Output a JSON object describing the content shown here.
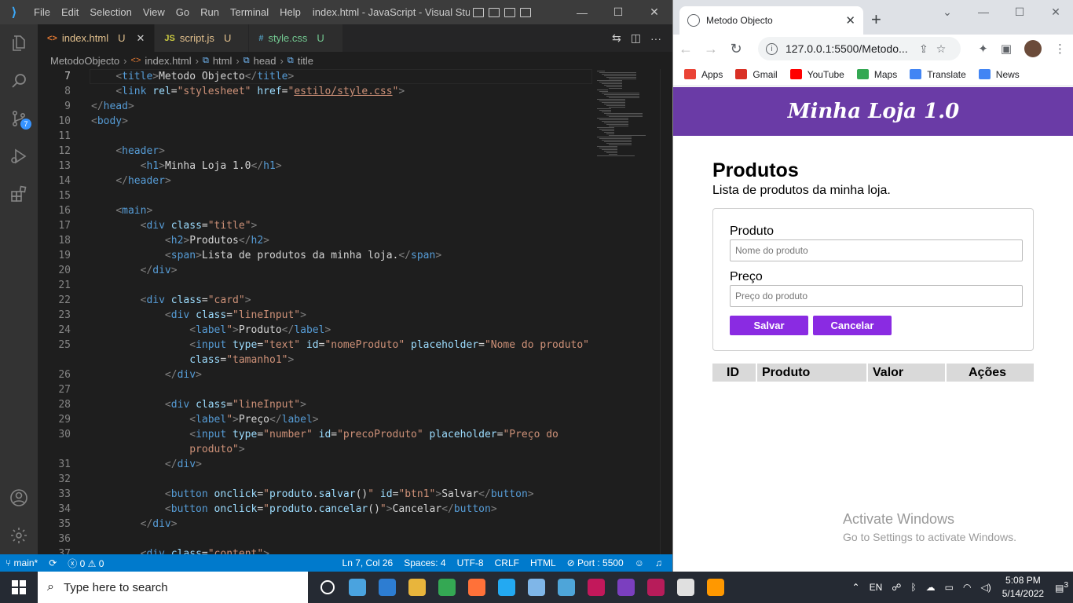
{
  "vscode": {
    "menu": [
      "File",
      "Edit",
      "Selection",
      "View",
      "Go",
      "Run",
      "Terminal",
      "Help"
    ],
    "window_title": "index.html - JavaScript - Visual Studio ...",
    "tabs": [
      {
        "icon": "<>",
        "label": "index.html",
        "status": "U",
        "active": true
      },
      {
        "icon": "JS",
        "label": "script.js",
        "status": "U",
        "active": false
      },
      {
        "icon": "#",
        "label": "style.css",
        "status": "U",
        "active": false
      }
    ],
    "breadcrumb": [
      "MetodoObjecto",
      "index.html",
      "html",
      "head",
      "title"
    ],
    "activity_badge": "7",
    "lines": [
      {
        "n": "7",
        "html": "    <span class='t'>&lt;</span><span class='tg'>title</span><span class='t'>&gt;</span><span class='tx'>Metodo Objecto</span><span class='t'>&lt;/</span><span class='tg'>title</span><span class='t'>&gt;</span>"
      },
      {
        "n": "8",
        "html": "    <span class='t'>&lt;</span><span class='tg'>link</span> <span class='at'>rel</span><span class='tx'>=</span><span class='st'>\"stylesheet\"</span> <span class='at'>href</span><span class='tx'>=</span><span class='st'>\"<span class='ul'>estilo/style.css</span>\"</span><span class='t'>&gt;</span>"
      },
      {
        "n": "9",
        "html": "<span class='t'>&lt;/</span><span class='tg'>head</span><span class='t'>&gt;</span>"
      },
      {
        "n": "10",
        "html": "<span class='t'>&lt;</span><span class='tg'>body</span><span class='t'>&gt;</span>"
      },
      {
        "n": "11",
        "html": ""
      },
      {
        "n": "12",
        "html": "    <span class='t'>&lt;</span><span class='tg'>header</span><span class='t'>&gt;</span>"
      },
      {
        "n": "13",
        "html": "        <span class='t'>&lt;</span><span class='tg'>h1</span><span class='t'>&gt;</span><span class='tx'>Minha Loja 1.0</span><span class='t'>&lt;/</span><span class='tg'>h1</span><span class='t'>&gt;</span>"
      },
      {
        "n": "14",
        "html": "    <span class='t'>&lt;/</span><span class='tg'>header</span><span class='t'>&gt;</span>"
      },
      {
        "n": "15",
        "html": ""
      },
      {
        "n": "16",
        "html": "    <span class='t'>&lt;</span><span class='tg'>main</span><span class='t'>&gt;</span>"
      },
      {
        "n": "17",
        "html": "        <span class='t'>&lt;</span><span class='tg'>div</span> <span class='at'>class</span><span class='tx'>=</span><span class='st'>\"title\"</span><span class='t'>&gt;</span>"
      },
      {
        "n": "18",
        "html": "            <span class='t'>&lt;</span><span class='tg'>h2</span><span class='t'>&gt;</span><span class='tx'>Produtos</span><span class='t'>&lt;/</span><span class='tg'>h2</span><span class='t'>&gt;</span>"
      },
      {
        "n": "19",
        "html": "            <span class='t'>&lt;</span><span class='tg'>span</span><span class='t'>&gt;</span><span class='tx'>Lista de produtos da minha loja.</span><span class='t'>&lt;/</span><span class='tg'>span</span><span class='t'>&gt;</span>"
      },
      {
        "n": "20",
        "html": "        <span class='t'>&lt;/</span><span class='tg'>div</span><span class='t'>&gt;</span>"
      },
      {
        "n": "21",
        "html": ""
      },
      {
        "n": "22",
        "html": "        <span class='t'>&lt;</span><span class='tg'>div</span> <span class='at'>class</span><span class='tx'>=</span><span class='st'>\"card\"</span><span class='t'>&gt;</span>"
      },
      {
        "n": "23",
        "html": "            <span class='t'>&lt;</span><span class='tg'>div</span> <span class='at'>class</span><span class='tx'>=</span><span class='st'>\"lineInput\"</span><span class='t'>&gt;</span>"
      },
      {
        "n": "24",
        "html": "                <span class='t'>&lt;</span><span class='tg'>label</span><span class='st'>\"</span><span class='t'>&gt;</span><span class='tx'>Produto</span><span class='t'>&lt;/</span><span class='tg'>label</span><span class='t'>&gt;</span>"
      },
      {
        "n": "25",
        "html": "                <span class='t'>&lt;</span><span class='tg'>input</span> <span class='at'>type</span><span class='tx'>=</span><span class='st'>\"text\"</span> <span class='at'>id</span><span class='tx'>=</span><span class='st'>\"nomeProduto\"</span> <span class='at'>placeholder</span><span class='tx'>=</span><span class='st'>\"Nome do produto\"</span>"
      },
      {
        "n": "",
        "html": "                <span class='at'>class</span><span class='tx'>=</span><span class='st'>\"tamanho1\"</span><span class='t'>&gt;</span>"
      },
      {
        "n": "26",
        "html": "            <span class='t'>&lt;/</span><span class='tg'>div</span><span class='t'>&gt;</span>"
      },
      {
        "n": "27",
        "html": ""
      },
      {
        "n": "28",
        "html": "            <span class='t'>&lt;</span><span class='tg'>div</span> <span class='at'>class</span><span class='tx'>=</span><span class='st'>\"lineInput\"</span><span class='t'>&gt;</span>"
      },
      {
        "n": "29",
        "html": "                <span class='t'>&lt;</span><span class='tg'>label</span><span class='st'>\"</span><span class='t'>&gt;</span><span class='tx'>Preço</span><span class='t'>&lt;/</span><span class='tg'>label</span><span class='t'>&gt;</span>"
      },
      {
        "n": "30",
        "html": "                <span class='t'>&lt;</span><span class='tg'>input</span> <span class='at'>type</span><span class='tx'>=</span><span class='st'>\"number\"</span> <span class='at'>id</span><span class='tx'>=</span><span class='st'>\"precoProduto\"</span> <span class='at'>placeholder</span><span class='tx'>=</span><span class='st'>\"Preço do</span>"
      },
      {
        "n": "",
        "html": "                <span class='st'>produto\"</span><span class='t'>&gt;</span>"
      },
      {
        "n": "31",
        "html": "            <span class='t'>&lt;/</span><span class='tg'>div</span><span class='t'>&gt;</span>"
      },
      {
        "n": "32",
        "html": ""
      },
      {
        "n": "33",
        "html": "            <span class='t'>&lt;</span><span class='tg'>button</span> <span class='at'>onclick</span><span class='tx'>=</span><span class='st'>\"</span><span class='at'>produto</span><span class='tx'>.</span><span class='at'>salvar</span><span class='tx'>()</span><span class='st'>\"</span> <span class='at'>id</span><span class='tx'>=</span><span class='st'>\"btn1\"</span><span class='t'>&gt;</span><span class='tx'>Salvar</span><span class='t'>&lt;/</span><span class='tg'>button</span><span class='t'>&gt;</span>"
      },
      {
        "n": "34",
        "html": "            <span class='t'>&lt;</span><span class='tg'>button</span> <span class='at'>onclick</span><span class='tx'>=</span><span class='st'>\"</span><span class='at'>produto</span><span class='tx'>.</span><span class='at'>cancelar</span><span class='tx'>()</span><span class='st'>\"</span><span class='t'>&gt;</span><span class='tx'>Cancelar</span><span class='t'>&lt;/</span><span class='tg'>button</span><span class='t'>&gt;</span>"
      },
      {
        "n": "35",
        "html": "        <span class='t'>&lt;/</span><span class='tg'>div</span><span class='t'>&gt;</span>"
      },
      {
        "n": "36",
        "html": ""
      },
      {
        "n": "37",
        "html": "        <span class='t'>&lt;</span><span class='tg'>div</span> <span class='at'>class</span><span class='tx'>=</span><span class='st'>\"content\"</span><span class='t'>&gt;</span>"
      }
    ],
    "current_line": "7",
    "status": {
      "branch": "main*",
      "errors": "0",
      "warnings": "0",
      "position": "Ln 7, Col 26",
      "spaces": "Spaces: 4",
      "encoding": "UTF-8",
      "eol": "CRLF",
      "language": "HTML",
      "port": "Port : 5500"
    }
  },
  "browser": {
    "tab_title": "Metodo Objecto",
    "url": "127.0.0.1:5500/Metodo...",
    "bookmarks": [
      {
        "label": "Apps",
        "color": "#ea4335"
      },
      {
        "label": "Gmail",
        "color": "#d93025"
      },
      {
        "label": "YouTube",
        "color": "#ff0000"
      },
      {
        "label": "Maps",
        "color": "#34a853"
      },
      {
        "label": "Translate",
        "color": "#4285f4"
      },
      {
        "label": "News",
        "color": "#4285f4"
      }
    ],
    "page": {
      "header": "Minha Loja 1.0",
      "title": "Produtos",
      "subtitle": "Lista de produtos da minha loja.",
      "label_produto": "Produto",
      "placeholder_produto": "Nome do produto",
      "label_preco": "Preço",
      "placeholder_preco": "Preço do produto",
      "btn_salvar": "Salvar",
      "btn_cancelar": "Cancelar",
      "table_headers": [
        "ID",
        "Produto",
        "Valor",
        "Ações"
      ],
      "accent_color": "#6a3ba6",
      "button_color": "#8a2be2"
    },
    "watermark": {
      "line1": "Activate Windows",
      "line2": "Go to Settings to activate Windows."
    }
  },
  "taskbar": {
    "search_placeholder": "Type here to search",
    "language": "EN",
    "time": "5:08 PM",
    "date": "5/14/2022",
    "notifications": "3",
    "apps": [
      "#ffffff",
      "#4aa3df",
      "#2d7dd2",
      "#e8b53c",
      "#34a853",
      "#ff7139",
      "#23a9f2",
      "#7fb6e8",
      "#4ea5d9",
      "#c2185b",
      "#7b3fbf",
      "#b71c5a",
      "#e0e0e0",
      "#ff9800"
    ]
  }
}
